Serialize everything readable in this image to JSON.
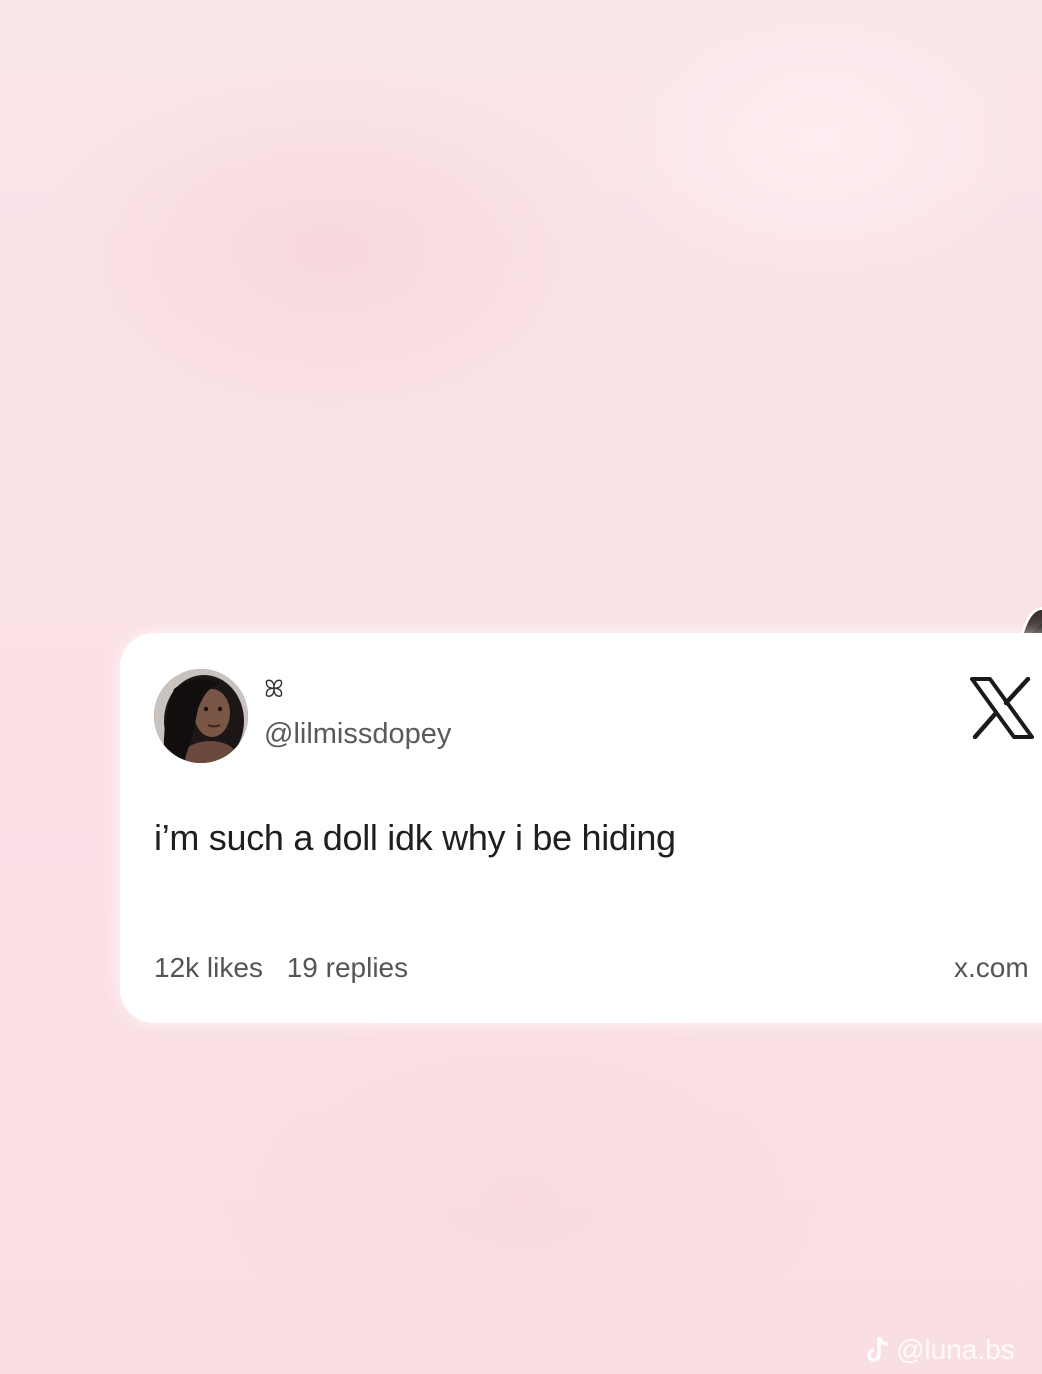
{
  "post": {
    "display_name": "ꕤ",
    "handle": "@lilmissdopey",
    "text": "i’m such a doll idk why i be hiding",
    "likes": "12k likes",
    "replies": "19 replies",
    "site": "x.com"
  },
  "icons": {
    "brand": "x-logo-icon",
    "avatar": "profile-photo",
    "watermark": "tiktok-icon"
  },
  "watermark": {
    "handle": "@luna.bs"
  },
  "colors": {
    "background": "#fbe3e7",
    "card": "#ffffff",
    "text": "#1f1f1f",
    "muted": "#555555"
  }
}
